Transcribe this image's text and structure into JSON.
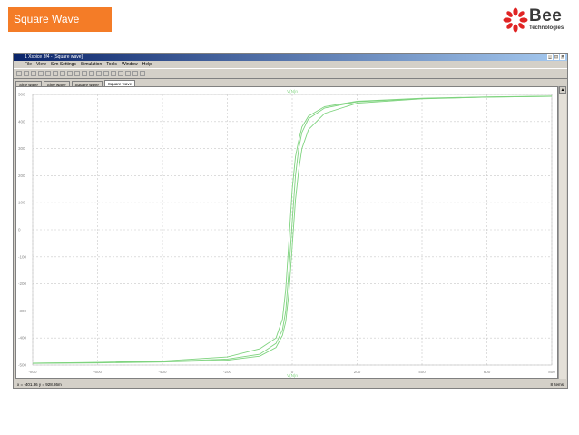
{
  "slide": {
    "title": "Square Wave"
  },
  "logo": {
    "main": "Bee",
    "sub": "Technologies",
    "accent": "#e02424"
  },
  "window": {
    "title": "1 Xspice 3f4 - [Square wave]",
    "menu": [
      "File",
      "View",
      "Sim Settings",
      "Simulation",
      "Tools",
      "Window",
      "Help"
    ],
    "toolbar_icons": [
      "new-icon",
      "open-icon",
      "save-icon",
      "cut-icon",
      "copy-icon",
      "paste-icon",
      "zoom-in-icon",
      "zoom-out-icon",
      "zoom-fit-icon",
      "grid-icon",
      "cursor-icon",
      "probe-icon",
      "run-icon",
      "stop-icon",
      "print-icon",
      "measure-icon",
      "settings-icon",
      "help-icon"
    ],
    "tabs": [
      {
        "label": "Sine wave",
        "active": false
      },
      {
        "label": "Sine wave",
        "active": false
      },
      {
        "label": "Square wave",
        "active": false
      },
      {
        "label": "Square wave",
        "active": true
      }
    ],
    "status": {
      "left": "x = -401.36   y = 928.86m",
      "right": "8 items"
    }
  },
  "chart_data": {
    "type": "line",
    "title": "V(N)n",
    "xlabel": "V(N)n",
    "xlim": [
      -800,
      800
    ],
    "ylim": [
      -500,
      500
    ],
    "x_ticks": [
      -800,
      -600,
      -400,
      -200,
      0,
      200,
      400,
      600,
      800
    ],
    "y_ticks": [
      -500,
      -400,
      -300,
      -200,
      -100,
      0,
      100,
      200,
      300,
      400,
      500
    ],
    "grid": true,
    "line_color": "#7ed37e",
    "series": [
      {
        "x": [
          -800,
          -600,
          -400,
          -200,
          -100,
          -50,
          -30,
          -20,
          -10,
          0,
          10,
          20,
          30,
          50,
          100,
          200,
          400,
          600,
          800
        ],
        "y": [
          -493,
          -491,
          -487,
          -478,
          -460,
          -420,
          -370,
          -300,
          -150,
          30,
          200,
          300,
          360,
          410,
          450,
          473,
          485,
          490,
          493
        ]
      },
      {
        "x": [
          -800,
          -600,
          -400,
          -200,
          -100,
          -50,
          -30,
          -20,
          -10,
          0,
          10,
          20,
          30,
          50,
          100,
          200,
          400,
          600,
          800
        ],
        "y": [
          -493,
          -490,
          -485,
          -470,
          -440,
          -400,
          -330,
          -220,
          -40,
          150,
          270,
          330,
          380,
          420,
          455,
          475,
          486,
          491,
          494
        ]
      },
      {
        "x": [
          -800,
          -600,
          -400,
          -200,
          -100,
          -50,
          -30,
          -20,
          -10,
          0,
          10,
          20,
          30,
          50,
          100,
          200,
          400,
          600,
          800
        ],
        "y": [
          -494,
          -492,
          -489,
          -482,
          -467,
          -435,
          -390,
          -340,
          -230,
          -60,
          110,
          220,
          300,
          370,
          430,
          468,
          484,
          490,
          493
        ]
      }
    ]
  }
}
